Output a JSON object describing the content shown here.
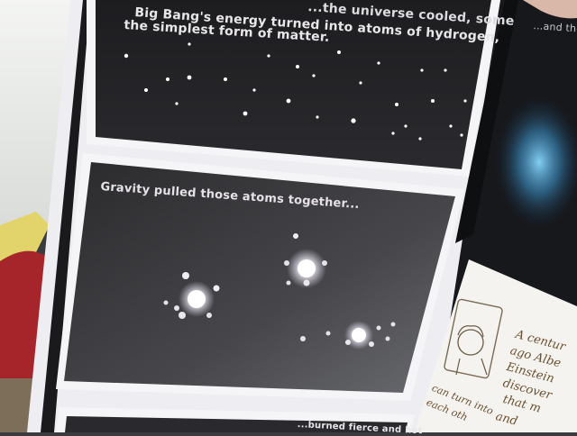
{
  "book": {
    "panel_top_caption_line1": "Big Bang's energy turned into atoms of hydrogen,",
    "panel_top_caption_line0": "...the universe cooled, some",
    "panel_top_caption_line2": "the simplest form of matter.",
    "panel_middle_caption": "Gravity pulled those atoms together...",
    "panel_bottom_caption": "...burned fierce and hot",
    "right_page_caption": "...and the"
  },
  "note_card": {
    "line1": "A centur",
    "line2": "ago Albe",
    "line3": "Einstein",
    "line4": "discover",
    "line5": "that m",
    "line6": "and",
    "line7": "can turn into",
    "line8": "each oth"
  }
}
